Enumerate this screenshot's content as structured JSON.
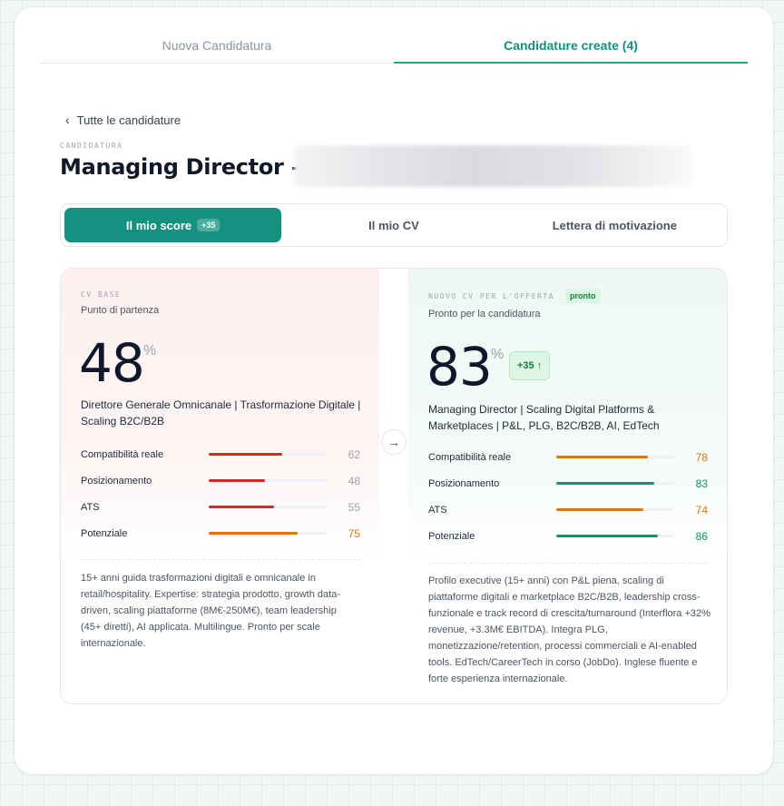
{
  "tabs": [
    "Nuova Candidatura",
    "Candidature create (4)"
  ],
  "back_label": "Tutte le candidature",
  "eyebrow": "CANDIDATURA",
  "title": "Managing Director –",
  "segments": [
    {
      "label": "Il mio score",
      "badge": "+35"
    },
    {
      "label": "Il mio CV"
    },
    {
      "label": "Lettera di motivazione"
    }
  ],
  "colors": {
    "accent": "#14917f",
    "red": "#dc2626",
    "orange": "#d97706",
    "green": "#059669"
  },
  "left": {
    "eyebrow": "CV BASE",
    "subtitle": "Punto di partenza",
    "score": "48",
    "percent": "%",
    "headline": "Direttore Generale Omnicanale | Trasformazione Digitale | Scaling B2C/B2B",
    "metrics": [
      {
        "label": "Compatibilità reale",
        "value": 62,
        "display": "62"
      },
      {
        "label": "Posizionamento",
        "value": 48,
        "display": "48"
      },
      {
        "label": "ATS",
        "value": 55,
        "display": "55"
      },
      {
        "label": "Potenziale",
        "value": 75,
        "display": "75"
      }
    ],
    "description": "15+ anni guida trasformazioni digitali e omnicanale in retail/hospitality. Expertise: strategia prodotto, growth data-driven, scaling piattaforme (8M€-250M€), team leadership (45+ diretti), AI applicata. Multilingue. Pronto per scale internazionale."
  },
  "right": {
    "eyebrow": "NUOVO CV PER L'OFFERTA",
    "badge": "pronto",
    "subtitle": "Pronto per la candidatura",
    "score": "83",
    "percent": "%",
    "delta": "+35 ↑",
    "headline": "Managing Director | Scaling Digital Platforms & Marketplaces | P&L, PLG, B2C/B2B, AI, EdTech",
    "metrics": [
      {
        "label": "Compatibilità reale",
        "value": 78,
        "display": "78"
      },
      {
        "label": "Posizionamento",
        "value": 83,
        "display": "83"
      },
      {
        "label": "ATS",
        "value": 74,
        "display": "74"
      },
      {
        "label": "Potenziale",
        "value": 86,
        "display": "86"
      }
    ],
    "description": "Profilo executive (15+ anni) con P&L piena, scaling di piattaforme digitali e marketplace B2C/B2B, leadership cross-funzionale e track record di crescita/turnaround (Interflora +32% revenue, +3.3M€ EBITDA). Integra PLG, monetizzazione/retention, processi commerciali e AI-enabled tools. EdTech/CareerTech in corso (JobDo). Inglese fluente e forte esperienza internazionale."
  }
}
